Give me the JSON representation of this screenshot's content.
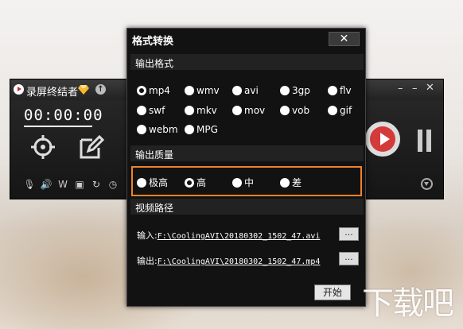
{
  "recorder": {
    "title": "录屏终结者",
    "time": "00:00:00",
    "min_glyph": "–",
    "close_glyph": "✕"
  },
  "dialog": {
    "title": "格式转换",
    "close_glyph": "✕",
    "output_format_label": "输出格式",
    "formats": [
      "mp4",
      "wmv",
      "avi",
      "3gp",
      "flv",
      "swf",
      "mkv",
      "mov",
      "vob",
      "gif",
      "webm",
      "MPG"
    ],
    "selected_format": "mp4",
    "output_quality_label": "输出质量",
    "qualities": [
      "极高",
      "高",
      "中",
      "差"
    ],
    "selected_quality": "高",
    "video_path_label": "视频路径",
    "input_label": "输入:",
    "input_path": "F:\\CoolingAVI\\20180302_1502_47.avi",
    "output_label": "输出:",
    "output_path": "F:\\CoolingAVI\\20180302_1502_47.mp4",
    "browse_label": "...",
    "start_label": "开始"
  },
  "colors": {
    "highlight_border": "#f0832a",
    "record_red": "#d43a3a"
  }
}
